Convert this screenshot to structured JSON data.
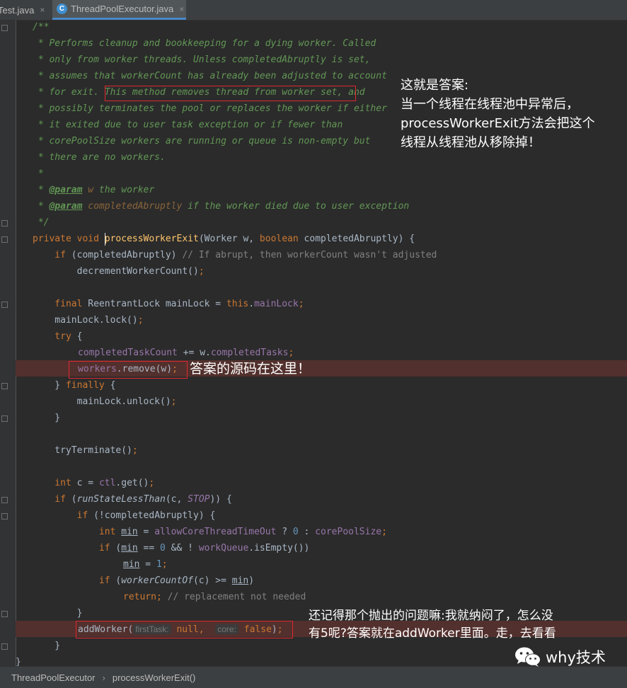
{
  "tabs": [
    {
      "label": "Test.java",
      "close": "×"
    },
    {
      "label": "ThreadPoolExecutor.java",
      "close": "×",
      "icon": "C"
    }
  ],
  "code": {
    "l01": "/**",
    "l02": " * Performs cleanup and bookkeeping for a dying worker. Called",
    "l03": " * only from worker threads. Unless completedAbruptly is set,",
    "l04": " * assumes that workerCount has already been adjusted to account",
    "l05a": " * for exit.",
    "l05b": " This method removes thread from worker set,",
    "l05c": " and",
    "l06": " * possibly terminates the pool or replaces the worker if either",
    "l07": " * it exited due to user task exception or if fewer than",
    "l08": " * corePoolSize workers are running or queue is non-empty but",
    "l09": " * there are no workers.",
    "l10": " *",
    "l11a": " * ",
    "l11tag": "@param",
    "l11v": " w",
    "l11d": " the worker",
    "l12a": " * ",
    "l12tag": "@param",
    "l12v": " completedAbruptly",
    "l12d": " if the worker died due to user exception",
    "l13": " */",
    "l14kw1": "private",
    "l14kw2": " void ",
    "l14m": "processWorkerExit",
    "l14p1": "(Worker w, ",
    "l14kw3": "boolean",
    "l14p2": " completedAbruptly) {",
    "l15kw": "    if",
    "l15a": " (completedAbruptly) ",
    "l15cm": "// If abrupt, then workerCount wasn't adjusted",
    "l16": "        decrementWorkerCount()",
    "l16s": ";",
    "l18kw": "    final",
    "l18a": " ReentrantLock mainLock = ",
    "l18kw2": "this",
    "l18dot": ".",
    "l18f": "mainLock",
    "l18s": ";",
    "l19": "    mainLock.lock()",
    "l19s": ";",
    "l20kw": "    try",
    "l20a": " {",
    "l21f1": "completedTaskCount",
    "l21a": " += w.",
    "l21f2": "completedTasks",
    "l21s": ";",
    "l22f": "workers",
    "l22a": ".remove(w)",
    "l22s": ";",
    "l23a": "    } ",
    "l23kw": "finally",
    "l23b": " {",
    "l24": "        mainLock.unlock()",
    "l24s": ";",
    "l25": "    }",
    "l27": "    tryTerminate()",
    "l27s": ";",
    "l29kw": "    int",
    "l29a": " c = ",
    "l29f": "ctl",
    "l29b": ".get()",
    "l29s": ";",
    "l30kw": "    if",
    "l30a": " (",
    "l30m": "runStateLessThan",
    "l30b": "(c, ",
    "l30sf": "STOP",
    "l30c": ")) {",
    "l31kw": "        if",
    "l31a": " (!completedAbruptly) {",
    "l32kw": "            int",
    "l32v": "min",
    "l32a": " = ",
    "l32f1": "allowCoreThreadTimeOut",
    "l32b": " ? ",
    "l32n": "0",
    "l32c": " : ",
    "l32f2": "corePoolSize",
    "l32s": ";",
    "l33kw": "            if",
    "l33a": " (",
    "l33v": "min",
    "l33b": " == ",
    "l33n": "0",
    "l33c": " && ! ",
    "l33f": "workQueue",
    "l33d": ".isEmpty())",
    "l34v": "min",
    "l34a": " = ",
    "l34n": "1",
    "l34s": ";",
    "l35kw": "            if",
    "l35a": " (",
    "l35m": "workerCountOf",
    "l35b": "(c) >= ",
    "l35v": "min",
    "l35c": ")",
    "l36kw": "return",
    "l36s": ";",
    "l36cm": " // replacement not needed",
    "l37": "        }",
    "l38a": "addWorker(",
    "l38h1": "firstTask:",
    "l38kw1": " null",
    "l38s": ",",
    "l38h2": "core:",
    "l38kw2": " false",
    "l38b": ")",
    "l38s2": ";",
    "l39": "    }",
    "l40": "}"
  },
  "annotations": {
    "right_note": [
      "这就是答案:",
      "当一个线程在线程池中异常后，",
      "processWorkerExit方法会把这个",
      "线程从线程池从移除掉！"
    ],
    "remove_note": "答案的源码在这里！",
    "bottom_note": [
      "还记得那个抛出的问题嘛:我就纳闷了，怎么没",
      "有5呢?答案就在addWorker里面。走，去看看"
    ]
  },
  "breadcrumb": {
    "class": "ThreadPoolExecutor",
    "sep": "›",
    "method": "processWorkerExit()"
  },
  "watermark": {
    "text": "why技术",
    "icon": "wechat-icon"
  }
}
